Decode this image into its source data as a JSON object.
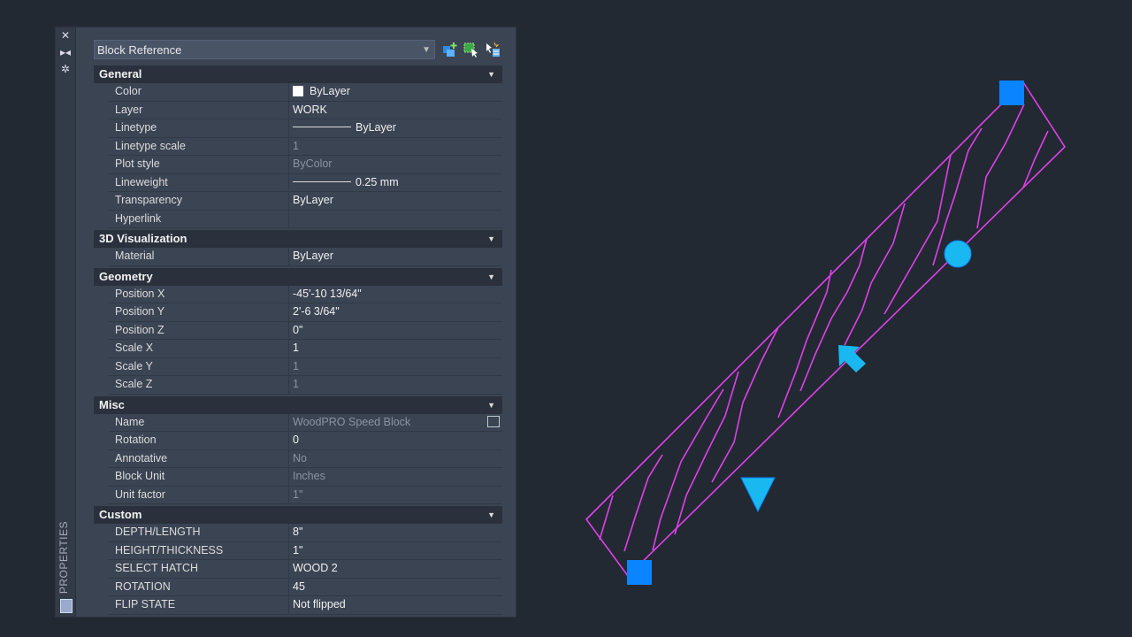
{
  "palette": {
    "title": "PROPERTIES",
    "selector": "Block Reference",
    "categories": [
      {
        "name": "General",
        "rows": [
          {
            "label": "Color",
            "value": "ByLayer",
            "swatch": true
          },
          {
            "label": "Layer",
            "value": "WORK"
          },
          {
            "label": "Linetype",
            "value": "ByLayer",
            "line": true
          },
          {
            "label": "Linetype scale",
            "value": "1",
            "dim": true
          },
          {
            "label": "Plot style",
            "value": "ByColor",
            "dim": true
          },
          {
            "label": "Lineweight",
            "value": "0.25 mm",
            "line": true
          },
          {
            "label": "Transparency",
            "value": "ByLayer"
          },
          {
            "label": "Hyperlink",
            "value": ""
          }
        ]
      },
      {
        "name": "3D Visualization",
        "rows": [
          {
            "label": "Material",
            "value": "ByLayer"
          }
        ]
      },
      {
        "name": "Geometry",
        "rows": [
          {
            "label": "Position X",
            "value": "-45'-10 13/64\""
          },
          {
            "label": "Position Y",
            "value": "2'-6 3/64\""
          },
          {
            "label": "Position Z",
            "value": "0\""
          },
          {
            "label": "Scale X",
            "value": "1"
          },
          {
            "label": "Scale Y",
            "value": "1",
            "dim": true
          },
          {
            "label": "Scale Z",
            "value": "1",
            "dim": true
          }
        ]
      },
      {
        "name": "Misc",
        "rows": [
          {
            "label": "Name",
            "value": "WoodPRO Speed Block",
            "dim": true,
            "pick": true
          },
          {
            "label": "Rotation",
            "value": "0"
          },
          {
            "label": "Annotative",
            "value": "No",
            "dim": true
          },
          {
            "label": "Block Unit",
            "value": "Inches",
            "dim": true
          },
          {
            "label": "Unit factor",
            "value": "1\"",
            "dim": true
          }
        ]
      },
      {
        "name": "Custom",
        "rows": [
          {
            "label": "DEPTH/LENGTH",
            "value": "8\""
          },
          {
            "label": "HEIGHT/THICKNESS",
            "value": "1\""
          },
          {
            "label": "SELECT HATCH",
            "value": "WOOD 2"
          },
          {
            "label": "ROTATION",
            "value": "45"
          },
          {
            "label": "FLIP STATE",
            "value": "Not flipped"
          }
        ]
      }
    ]
  },
  "colors": {
    "outline": "#e040e8",
    "grip": "#0a84ff",
    "grip_light": "#1ab8f0"
  }
}
